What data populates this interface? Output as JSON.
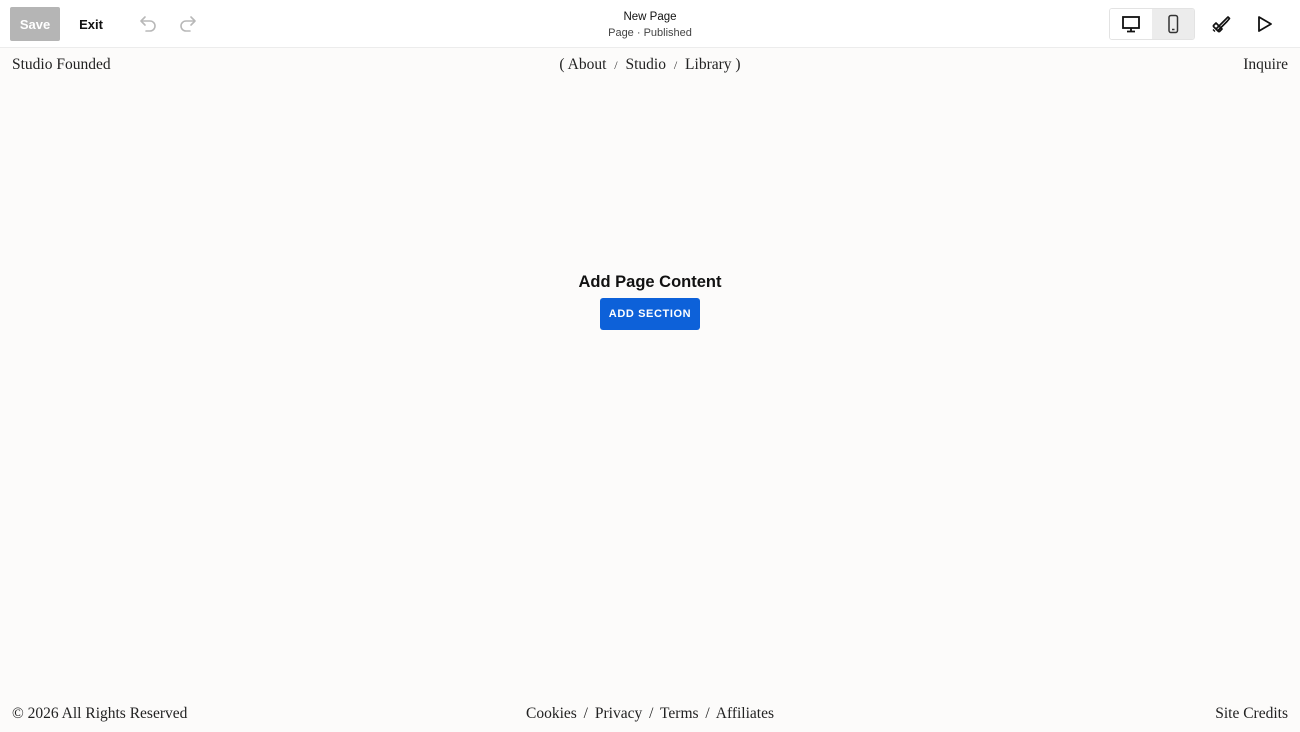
{
  "toolbar": {
    "save_label": "Save",
    "exit_label": "Exit",
    "page_title": "New Page",
    "page_status": "Page · Published",
    "icons": {
      "undo": "undo-icon",
      "redo": "redo-icon",
      "desktop": "desktop-icon",
      "mobile": "mobile-icon",
      "design": "paintbrush-icon",
      "preview": "play-icon"
    }
  },
  "site_header": {
    "title": "Studio Founded",
    "nav_open": "(",
    "nav_close": ")",
    "nav_separator": "/",
    "nav_items": [
      "About",
      "Studio",
      "Library"
    ],
    "inquire": "Inquire"
  },
  "empty_state": {
    "heading": "Add Page Content",
    "button_label": "ADD SECTION"
  },
  "footer": {
    "copyright": "© 2026 All Rights Reserved",
    "separator": "/",
    "links": [
      "Cookies",
      "Privacy",
      "Terms",
      "Affiliates"
    ],
    "credits": "Site Credits"
  },
  "colors": {
    "save_disabled": "#b5b5b5",
    "accent_button": "#0d61d9",
    "canvas_background": "#fcfbfa"
  }
}
